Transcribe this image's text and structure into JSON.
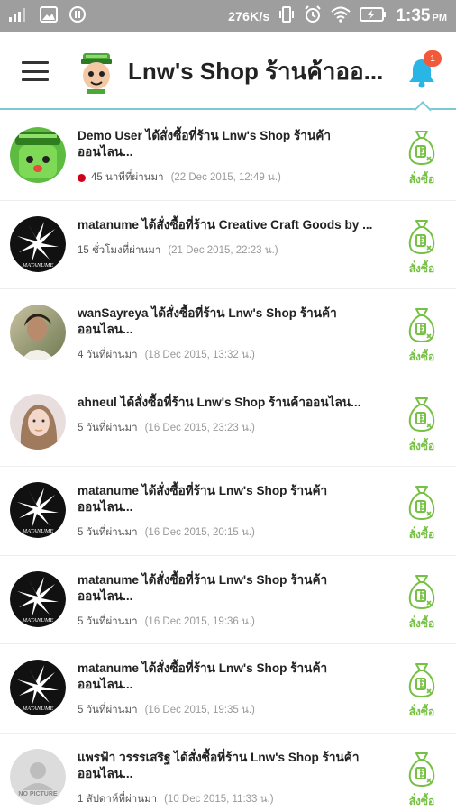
{
  "status_bar": {
    "speed": "276K/s",
    "time": "1:35",
    "ampm": "PM"
  },
  "app_bar": {
    "title": "Lnw's Shop ร้านค้าออ..."
  },
  "notifications_badge": "1",
  "action_label": "สั่งซื้อ",
  "no_picture_text": "NO PICTURE",
  "matanume_logo_text": "MATANUME",
  "colors": {
    "accent_green": "#76c043",
    "divider_teal": "#7ec8d6",
    "badge_red": "#f05a3a",
    "bell_blue": "#29b6e6",
    "status_bar": "#9e9e9e",
    "unread_dot": "#d0021b"
  },
  "items": [
    {
      "avatar": "green-robot-avatar",
      "message_lines": [
        "Demo User ได้สั่งซื้อที่ร้าน Lnw's Shop ร้านค้า",
        "ออนไลน..."
      ],
      "time_ago": "45 นาทีที่ผ่านมา",
      "date": "(22 Dec 2015, 12:49 น.)",
      "unread": true
    },
    {
      "avatar": "matanume-avatar",
      "message_lines": [
        "matanume ได้สั่งซื้อที่ร้าน Creative Craft Goods by ..."
      ],
      "time_ago": "15 ชั่วโมงที่ผ่านมา",
      "date": "(21 Dec 2015, 22:23 น.)",
      "unread": false
    },
    {
      "avatar": "photo-avatar-wansayreya",
      "message_lines": [
        "wanSayreya ได้สั่งซื้อที่ร้าน Lnw's Shop ร้านค้า",
        "ออนไลน..."
      ],
      "time_ago": "4 วันที่ผ่านมา",
      "date": "(18 Dec 2015, 13:32 น.)",
      "unread": false
    },
    {
      "avatar": "photo-avatar-ahneul",
      "message_lines": [
        "ahneul ได้สั่งซื้อที่ร้าน Lnw's Shop ร้านค้าออนไลน..."
      ],
      "time_ago": "5 วันที่ผ่านมา",
      "date": "(16 Dec 2015, 23:23 น.)",
      "unread": false
    },
    {
      "avatar": "matanume-avatar",
      "message_lines": [
        "matanume ได้สั่งซื้อที่ร้าน Lnw's Shop ร้านค้า",
        "ออนไลน..."
      ],
      "time_ago": "5 วันที่ผ่านมา",
      "date": "(16 Dec 2015, 20:15 น.)",
      "unread": false
    },
    {
      "avatar": "matanume-avatar",
      "message_lines": [
        "matanume ได้สั่งซื้อที่ร้าน Lnw's Shop ร้านค้า",
        "ออนไลน..."
      ],
      "time_ago": "5 วันที่ผ่านมา",
      "date": "(16 Dec 2015, 19:36 น.)",
      "unread": false
    },
    {
      "avatar": "matanume-avatar",
      "message_lines": [
        "matanume ได้สั่งซื้อที่ร้าน Lnw's Shop ร้านค้า",
        "ออนไลน..."
      ],
      "time_ago": "5 วันที่ผ่านมา",
      "date": "(16 Dec 2015, 19:35 น.)",
      "unread": false
    },
    {
      "avatar": "no-picture-avatar",
      "message_lines": [
        "แพรฟ้า วรรรเสริฐ ได้สั่งซื้อที่ร้าน Lnw's Shop ร้านค้า",
        "ออนไลน..."
      ],
      "time_ago": "1 สัปดาห์ที่ผ่านมา",
      "date": "(10 Dec 2015, 11:33 น.)",
      "unread": false
    }
  ]
}
